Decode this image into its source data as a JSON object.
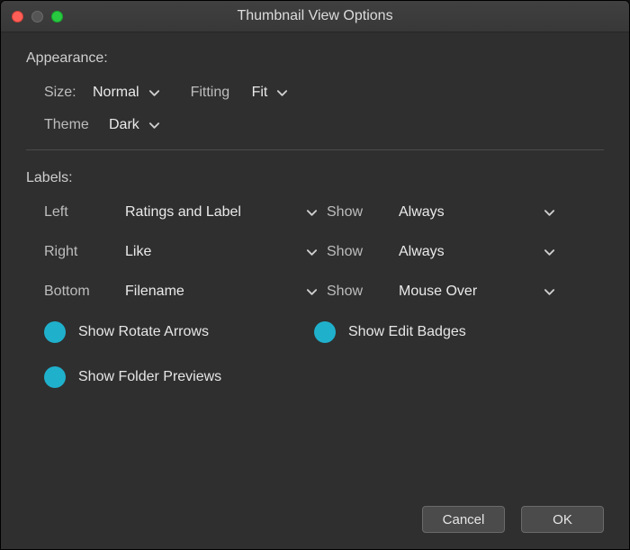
{
  "window": {
    "title": "Thumbnail View Options"
  },
  "appearance": {
    "heading": "Appearance:",
    "size_label": "Size:",
    "size_value": "Normal",
    "fitting_label": "Fitting",
    "fitting_value": "Fit",
    "theme_label": "Theme",
    "theme_value": "Dark"
  },
  "labels": {
    "heading": "Labels:",
    "rows": [
      {
        "pos_label": "Left",
        "value": "Ratings and Label",
        "show_label": "Show",
        "show_value": "Always"
      },
      {
        "pos_label": "Right",
        "value": "Like",
        "show_label": "Show",
        "show_value": "Always"
      },
      {
        "pos_label": "Bottom",
        "value": "Filename",
        "show_label": "Show",
        "show_value": "Mouse Over"
      }
    ]
  },
  "toggles": {
    "rotate_arrows": {
      "label": "Show Rotate Arrows",
      "on": true
    },
    "edit_badges": {
      "label": "Show Edit Badges",
      "on": true
    },
    "folder_previews": {
      "label": "Show Folder Previews",
      "on": true
    }
  },
  "footer": {
    "cancel": "Cancel",
    "ok": "OK"
  },
  "colors": {
    "accent": "#1fb0cc",
    "close_red": "#ff5f57",
    "max_green": "#28c840"
  }
}
